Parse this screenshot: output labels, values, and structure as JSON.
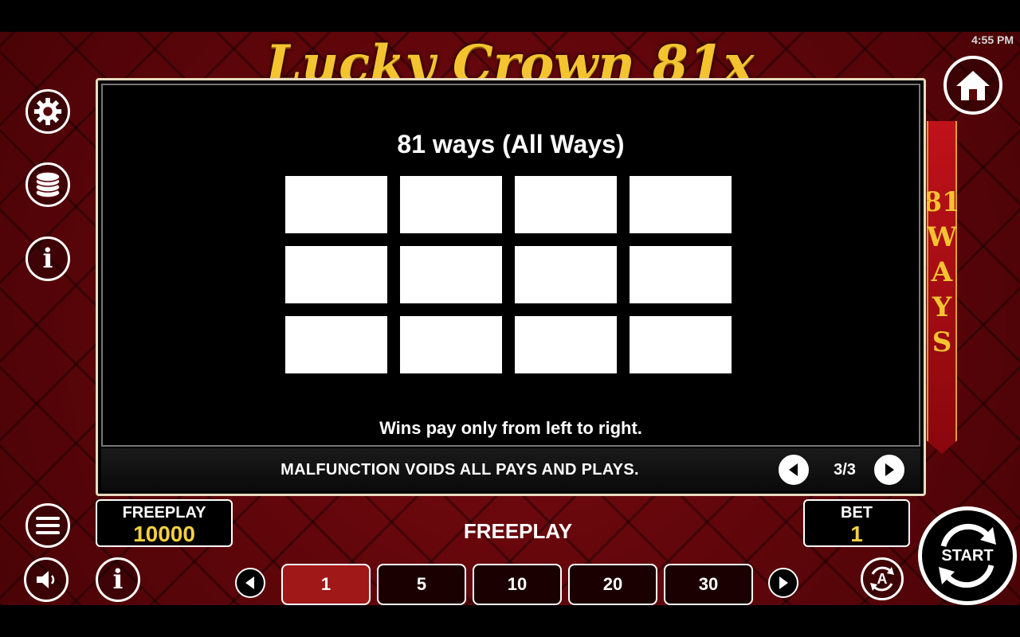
{
  "status_bar": {
    "clock": "4:55 PM"
  },
  "game": {
    "title": "Lucky Crown 81x"
  },
  "ways_banner": {
    "number": "81",
    "letters": [
      "W",
      "A",
      "Y",
      "S"
    ]
  },
  "paytable": {
    "heading": "81 ways (All Ways)",
    "grid": {
      "rows": 3,
      "columns": 4
    },
    "note": "Wins pay only from left to right.",
    "disclaimer": "MALFUNCTION VOIDS ALL PAYS AND PLAYS.",
    "page_indicator": "3/3"
  },
  "balance": {
    "label": "FREEPLAY",
    "value": "10000"
  },
  "mode_label": "FREEPLAY",
  "bet": {
    "label": "BET",
    "value": "1"
  },
  "coin_values": [
    {
      "label": "1",
      "active": true
    },
    {
      "label": "5",
      "active": false
    },
    {
      "label": "10",
      "active": false
    },
    {
      "label": "20",
      "active": false
    },
    {
      "label": "30",
      "active": false
    }
  ],
  "start_label": "START",
  "autoplay_label": "A",
  "info_label": "i",
  "icons": {
    "settings": "gear-icon",
    "coins": "coin-stack-icon",
    "info": "info-icon",
    "menu": "hamburger-menu-icon",
    "sound": "speaker-icon",
    "home": "home-icon",
    "autoplay": "autoplay-icon",
    "start": "spin-arrows-icon"
  },
  "colors": {
    "accent_gold": "#f4d03f",
    "active_coin": "#a01818",
    "background_red": "#5a0508"
  }
}
